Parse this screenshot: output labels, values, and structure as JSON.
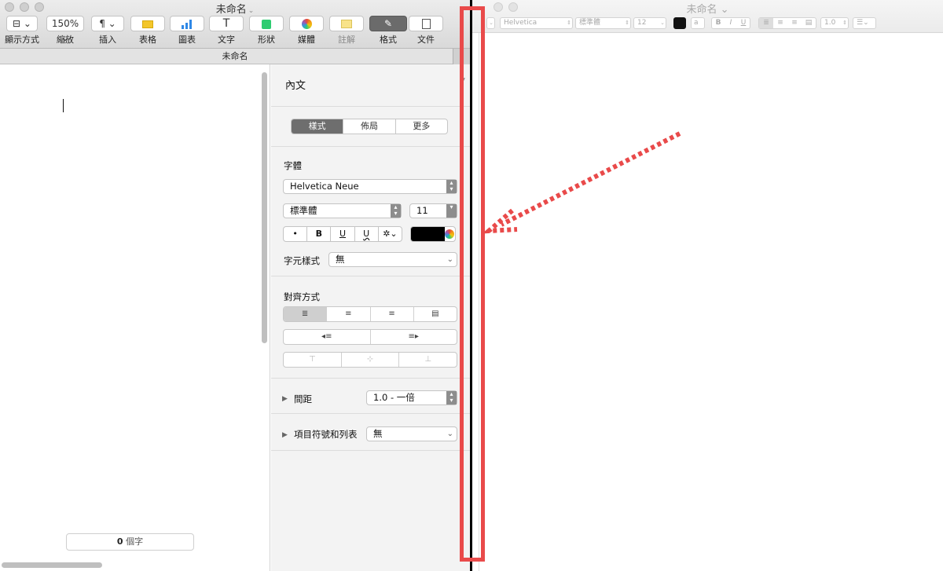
{
  "left_window": {
    "title": "未命名",
    "toolbar": [
      {
        "label": "顯示方式",
        "icon": "view-icon",
        "button": "⊟ ⌄"
      },
      {
        "label": "縮放",
        "icon": "zoom-icon",
        "button": "150% ⌄"
      },
      {
        "label": "插入",
        "icon": "paragraph-icon",
        "button": "¶ ⌄"
      },
      {
        "label": "表格",
        "icon": "table-icon"
      },
      {
        "label": "圖表",
        "icon": "chart-icon"
      },
      {
        "label": "文字",
        "icon": "text-icon",
        "button": "T"
      },
      {
        "label": "形狀",
        "icon": "shape-icon"
      },
      {
        "label": "媒體",
        "icon": "media-icon"
      },
      {
        "label": "註解",
        "icon": "comment-icon"
      },
      {
        "label": "格式",
        "icon": "format-brush-icon"
      },
      {
        "label": "文件",
        "icon": "document-icon"
      }
    ],
    "doc_bar_title": "未命名",
    "word_count": {
      "number": "0",
      "unit": "個字"
    }
  },
  "inspector": {
    "title": "內文",
    "tabs": [
      "樣式",
      "佈局",
      "更多"
    ],
    "active_tab": "樣式",
    "font_section_label": "字體",
    "font_family": "Helvetica Neue",
    "font_style": "標準體",
    "font_size": "11",
    "format_buttons": [
      "•",
      "B",
      "U",
      "U",
      "✲⌄"
    ],
    "text_color": "#000000",
    "char_style_label": "字元樣式",
    "char_style_value": "無",
    "alignment_label": "對齊方式",
    "align_buttons": [
      "≣",
      "≡",
      "≡",
      "▤"
    ],
    "indent_buttons": [
      "◂≡",
      "≡▸"
    ],
    "vertical_buttons": [
      "⊤",
      "⊹",
      "⊥"
    ],
    "spacing_label": "間距",
    "spacing_value": "1.0 - 一倍",
    "bullets_label": "項目符號和列表",
    "bullets_value": "無"
  },
  "right_window": {
    "title": "未命名",
    "font_family": "Helvetica",
    "font_style": "標準體",
    "font_size": "12",
    "format_buttons": [
      "B",
      "I",
      "U"
    ],
    "line_spacing": "1.0",
    "list_button": "☰⌄"
  },
  "annotation": {
    "highlight_color": "#e94a4a"
  }
}
